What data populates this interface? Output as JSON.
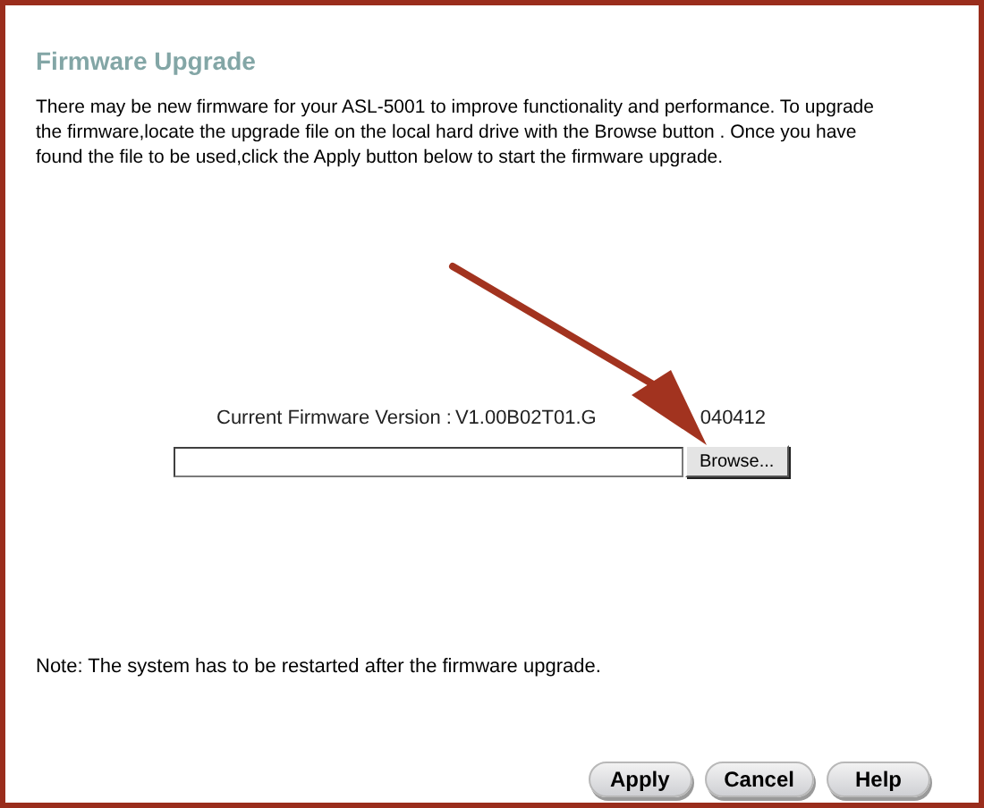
{
  "title": "Firmware Upgrade",
  "intro": "There may be new firmware for your ASL-5001 to improve functionality and performance. To upgrade the firmware,locate the upgrade file on the local hard drive with the Browse button . Once you have found the file to be used,click the Apply button below to start the firmware upgrade.",
  "firmware_version": {
    "label": "Current Firmware Version :",
    "value_visible_start": "V1.00B02T01.G",
    "value_visible_end": "040412"
  },
  "file_field": {
    "browse_button": "Browse..."
  },
  "note": "Note: The system has to be restarted after the firmware upgrade.",
  "buttons": [
    "Apply",
    "Cancel",
    "Help"
  ]
}
